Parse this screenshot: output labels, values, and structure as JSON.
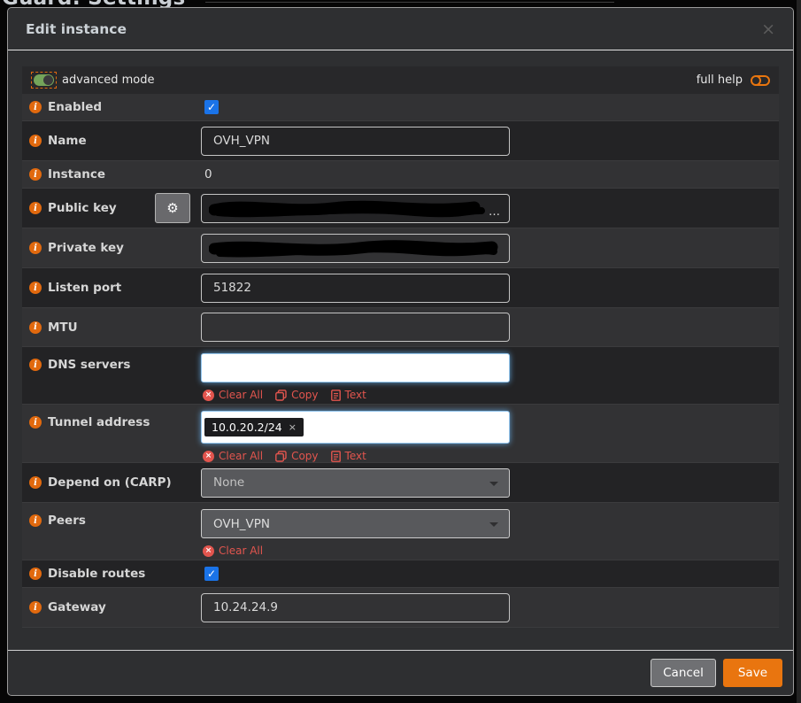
{
  "page": {
    "background_title": "Guard: Settings"
  },
  "modal": {
    "title": "Edit instance",
    "icons": {
      "close": "×",
      "gear": "⚙",
      "check": "✓",
      "info": "i",
      "ellipsis": "…",
      "token_remove": "×",
      "clear_x": "×"
    },
    "toolbar": {
      "advanced_label": "advanced mode",
      "full_help_label": "full help"
    },
    "actions": {
      "clear_all": "Clear All",
      "copy": "Copy",
      "text": "Text"
    },
    "fields": {
      "enabled": {
        "label": "Enabled",
        "checked": true
      },
      "name": {
        "label": "Name",
        "value": "OVH_VPN"
      },
      "instance": {
        "label": "Instance",
        "value": "0"
      },
      "public_key": {
        "label": "Public key",
        "value": "(redacted)"
      },
      "private_key": {
        "label": "Private key",
        "value": "(redacted)"
      },
      "listen_port": {
        "label": "Listen port",
        "value": "51822"
      },
      "mtu": {
        "label": "MTU",
        "value": ""
      },
      "dns_servers": {
        "label": "DNS servers",
        "value": ""
      },
      "tunnel_address": {
        "label": "Tunnel address",
        "token": "10.0.20.2/24"
      },
      "depend_carp": {
        "label": "Depend on (CARP)",
        "value": "None"
      },
      "peers": {
        "label": "Peers",
        "value": "OVH_VPN"
      },
      "disable_routes": {
        "label": "Disable routes",
        "checked": true
      },
      "gateway": {
        "label": "Gateway",
        "value": "10.24.24.9"
      }
    },
    "footer": {
      "cancel": "Cancel",
      "save": "Save"
    },
    "colors": {
      "accent_orange": "#e9750f",
      "link_red": "#e2554e",
      "checkbox_blue": "#1a73e8",
      "toggle_green": "#74a45a"
    }
  }
}
